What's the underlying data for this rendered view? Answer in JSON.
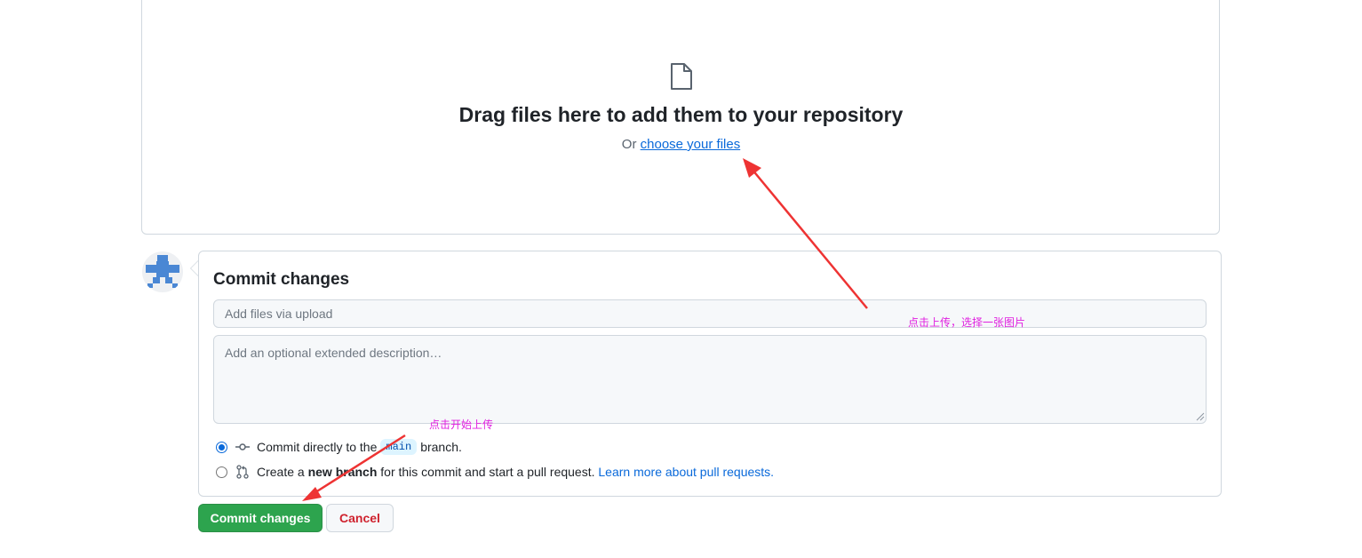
{
  "upload": {
    "title": "Drag files here to add them to your repository",
    "or_text": "Or",
    "choose_link": "choose your files"
  },
  "commit": {
    "title": "Commit changes",
    "summary_placeholder": "Add files via upload",
    "description_placeholder": "Add an optional extended description…",
    "option_direct": {
      "before": "Commit directly to the",
      "branch": "main",
      "after": "branch."
    },
    "option_new": {
      "before": "Create a",
      "bold": "new branch",
      "after": "for this commit and start a pull request.",
      "link": "Learn more about pull requests."
    },
    "commit_button": "Commit changes",
    "cancel_button": "Cancel"
  },
  "annotations": {
    "choose_files_note": "点击上传，选择一张图片",
    "commit_note": "点击开始上传"
  },
  "colors": {
    "primary_button": "#2da44e",
    "link": "#0969da",
    "cancel_text": "#cf222e",
    "annotation_arrow": "#ee3333",
    "annotation_text": "#e020e0"
  },
  "icons": [
    "file-icon",
    "commit-icon",
    "pull-request-icon",
    "avatar-identicon"
  ]
}
